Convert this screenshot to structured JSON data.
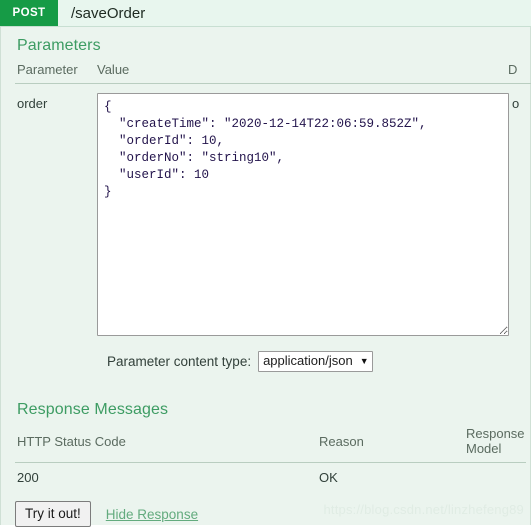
{
  "operation": {
    "method": "POST",
    "path": "/saveOrder"
  },
  "parameters_section": {
    "title": "Parameters",
    "columns": {
      "parameter": "Parameter",
      "value": "Value",
      "description": "D"
    },
    "rows": [
      {
        "name": "order",
        "value": "{\n  \"createTime\": \"2020-12-14T22:06:59.852Z\",\n  \"orderId\": 10,\n  \"orderNo\": \"string10\",\n  \"userId\": 10\n}",
        "description": "o"
      }
    ],
    "content_type": {
      "label": "Parameter content type:",
      "selected": "application/json",
      "options": [
        "application/json"
      ],
      "caret": "chevron-down-icon"
    }
  },
  "response_section": {
    "title": "Response Messages",
    "columns": {
      "status_code": "HTTP Status Code",
      "reason": "Reason",
      "model": "Response Model"
    },
    "rows": [
      {
        "status_code": "200",
        "reason": "OK",
        "model": ""
      }
    ]
  },
  "footer": {
    "try_button": "Try it out!",
    "hide_response": "Hide Response"
  },
  "watermark": {
    "text": "https://blog.csdn.net/linzhefeng89"
  },
  "colors": {
    "method_post": "#169b46",
    "section_title": "#3d9c63",
    "body_background": "#ebf4ee",
    "header_background": "#e8f6ee",
    "link": "#63ab7e",
    "json_text": "#22134b"
  }
}
